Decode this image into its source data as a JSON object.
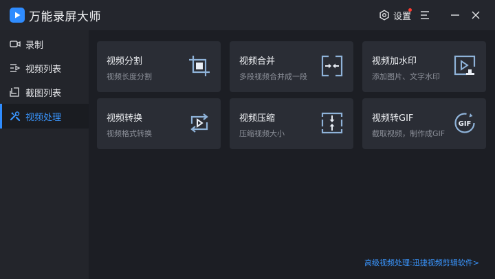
{
  "app": {
    "title": "万能录屏大师"
  },
  "titlebar": {
    "settings_label": "设置",
    "icons": [
      "gear-icon",
      "menu-icon",
      "minimize-icon",
      "close-icon"
    ]
  },
  "sidebar": {
    "items": [
      {
        "label": "录制",
        "icon": "camera-icon",
        "active": false
      },
      {
        "label": "视频列表",
        "icon": "video-list-icon",
        "active": false
      },
      {
        "label": "截图列表",
        "icon": "screenshot-list-icon",
        "active": false
      },
      {
        "label": "视频处理",
        "icon": "tools-icon",
        "active": true
      }
    ]
  },
  "cards": [
    {
      "title": "视频分割",
      "desc": "视频长度分割",
      "icon": "crop-icon"
    },
    {
      "title": "视频合并",
      "desc": "多段视频合并成一段",
      "icon": "merge-icon"
    },
    {
      "title": "视频加水印",
      "desc": "添加图片、文字水印",
      "icon": "watermark-icon"
    },
    {
      "title": "视频转换",
      "desc": "视频格式转换",
      "icon": "convert-icon"
    },
    {
      "title": "视频压缩",
      "desc": "压缩视频大小",
      "icon": "compress-icon"
    },
    {
      "title": "视频转GIF",
      "desc": "截取视频，制作成GIF",
      "icon": "gif-icon"
    }
  ],
  "footer": {
    "link_text": "高级视频处理:迅捷视频剪辑软件>"
  },
  "colors": {
    "accent": "#2f8cff",
    "background": "#1c1e24",
    "card": "#2a2d35",
    "icon": "#8fb3d9",
    "badge": "#ff3b30"
  }
}
